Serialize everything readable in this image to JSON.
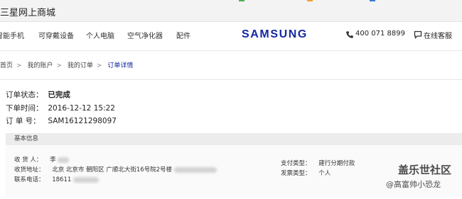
{
  "window": {
    "title": "三星网上商城"
  },
  "nav": {
    "items": [
      "智能手机",
      "可穿戴设备",
      "个人电脑",
      "空气净化器",
      "配件"
    ],
    "brand": "SAMSUNG",
    "phone": "400 071 8899",
    "chat": "在线客服"
  },
  "breadcrumb": [
    "首页",
    "我的账户",
    "我的订单",
    "订单详情"
  ],
  "order": {
    "status_label": "订单状态：",
    "status": "已完成",
    "time_label": "下单时间：",
    "time": "2016-12-12 15:22",
    "number_label": "订 单 号：",
    "number": "SAM16121298097"
  },
  "basic_info": {
    "heading": "基本信息",
    "receiver_label": "收 货 人：",
    "receiver": "李",
    "address_label": "收货地址：",
    "address": "北京  北京市  朝阳区  广顺北大街16号院2号楼",
    "phone_label": "联系电话：",
    "phone": "18611",
    "payment_label": "支付类型：",
    "payment": "建行分期付款",
    "invoice_label": "发票类型：",
    "invoice": "个人"
  },
  "watermark": {
    "line1": "盖乐世社区",
    "line2": "@高富帅小恐龙"
  }
}
